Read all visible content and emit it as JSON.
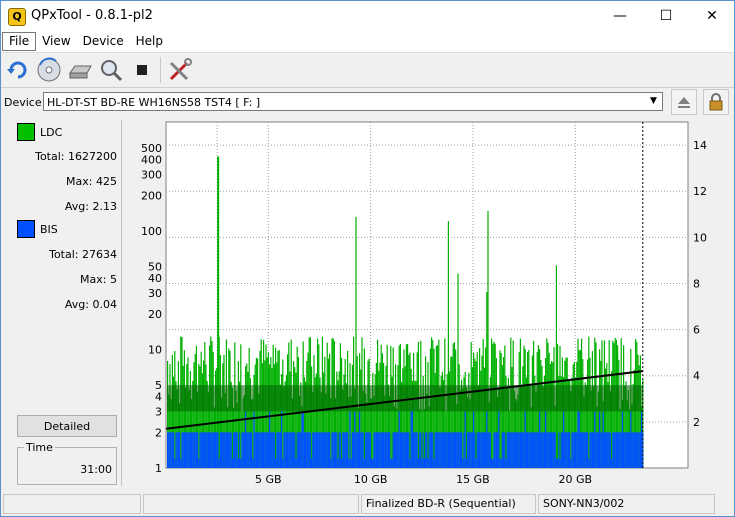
{
  "window": {
    "title": "QPxTool - 0.8.1-pl2",
    "app_icon": "Q",
    "minimize": "—",
    "maximize": "☐",
    "close": "✕"
  },
  "menu": [
    "File",
    "View",
    "Device",
    "Help"
  ],
  "device": {
    "label": "Device:",
    "selected": "HL-DT-ST BD-RE  WH16NS58  TST4 [ F: ]",
    "arrow": "▼"
  },
  "legend": {
    "ldc": {
      "name": "LDC",
      "color": "#00c000",
      "total_label": "Total:",
      "total": "1627200",
      "max_label": "Max:",
      "max": "425",
      "avg_label": "Avg:",
      "avg": "2.13"
    },
    "bis": {
      "name": "BIS",
      "color": "#0050ff",
      "total_label": "Total:",
      "total": "27634",
      "max_label": "Max:",
      "max": "5",
      "avg_label": "Avg:",
      "avg": "0.04"
    }
  },
  "detailed_button": "Detailed",
  "time": {
    "label": "Time",
    "value": "31:00"
  },
  "status": {
    "cell1": "",
    "cell2": "",
    "disc": "Finalized BD-R (Sequential)",
    "media": "SONY-NN3/002"
  },
  "icons": [
    "refresh-icon",
    "disc-scan-icon",
    "drive-icon",
    "magnifier-icon",
    "stop-icon",
    "tools-icon",
    "eject-icon",
    "lock-icon"
  ],
  "chart_data": {
    "type": "bar",
    "x_ticks": [
      "5 GB",
      "10 GB",
      "15 GB",
      "20 GB"
    ],
    "x_tick_values": [
      5,
      10,
      15,
      20
    ],
    "xlim": [
      0,
      25
    ],
    "data_end_gb": 23.3,
    "y_left_ticks": [
      "500",
      "400",
      "300",
      "200",
      "100",
      "50",
      "40",
      "30",
      "20",
      "10",
      "5",
      "4",
      "3",
      "2",
      "1"
    ],
    "y_left_values": [
      500,
      400,
      300,
      200,
      100,
      50,
      40,
      30,
      20,
      10,
      5,
      4,
      3,
      2,
      1
    ],
    "y_left_scale": "log",
    "y_right_ticks": [
      "14",
      "12",
      "10",
      "8",
      "6",
      "4",
      "2"
    ],
    "y_right_values": [
      14,
      12,
      10,
      8,
      6,
      4,
      2
    ],
    "y_right_lim": [
      0,
      15
    ],
    "series": [
      {
        "name": "LDC",
        "color": "#00c000",
        "typical_range": [
          3,
          20
        ],
        "peak": 425,
        "peak_at_gb": 2.5
      },
      {
        "name": "BIS",
        "color": "#0050ff",
        "typical_range": [
          2,
          3
        ],
        "max": 5
      },
      {
        "name": "speed",
        "color": "#000000",
        "x": [
          0,
          23.3
        ],
        "y": [
          1.7,
          4.2
        ]
      }
    ],
    "grid": true
  }
}
